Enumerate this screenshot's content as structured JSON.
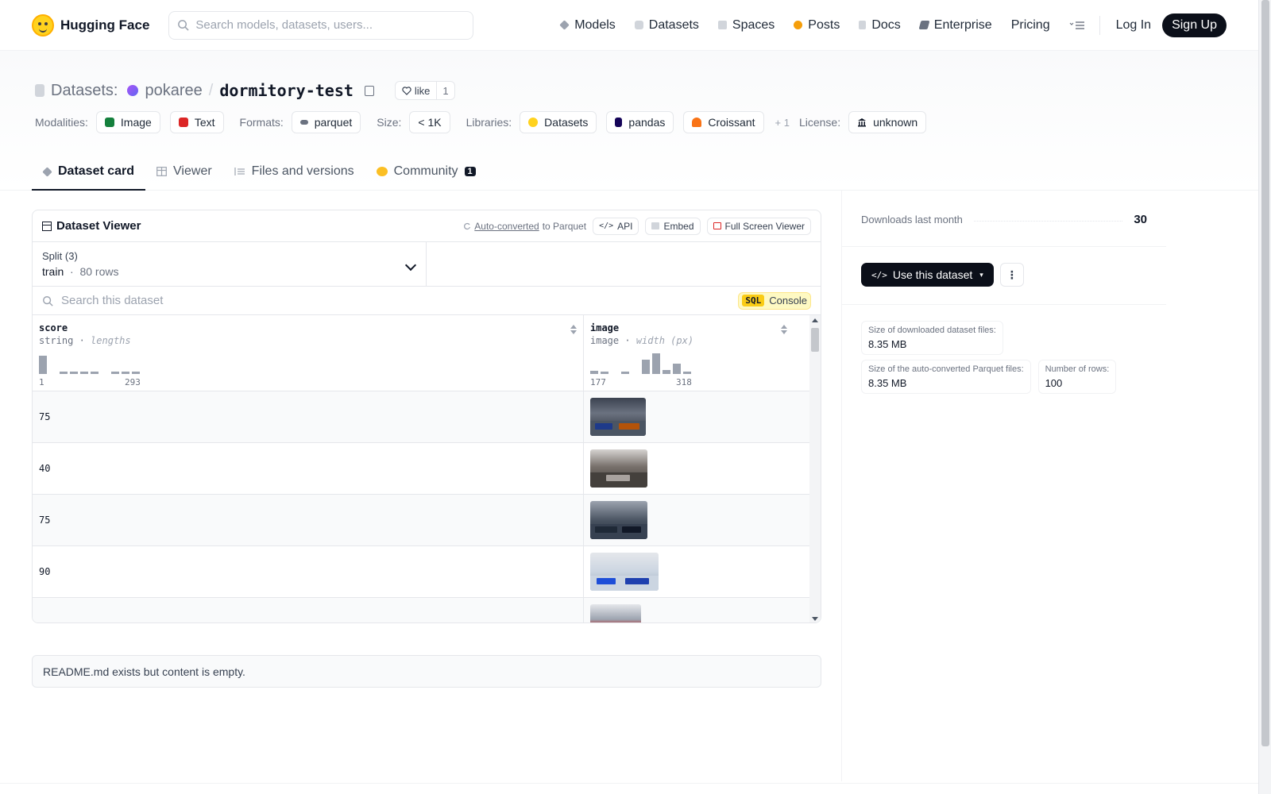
{
  "nav": {
    "brand": "Hugging Face",
    "search_placeholder": "Search models, datasets, users...",
    "links": [
      {
        "label": "Models",
        "icon": "cube-icon",
        "color": "#9ca3af"
      },
      {
        "label": "Datasets",
        "icon": "database-icon",
        "color": "#9ca3af"
      },
      {
        "label": "Spaces",
        "icon": "grid-icon",
        "color": "#9ca3af"
      },
      {
        "label": "Posts",
        "icon": "speech-icon",
        "color": "#f59e0b"
      },
      {
        "label": "Docs",
        "icon": "doc-icon",
        "color": "#9ca3af"
      },
      {
        "label": "Enterprise",
        "icon": "enterprise-icon",
        "color": "#6b7280"
      },
      {
        "label": "Pricing"
      }
    ],
    "login": "Log In",
    "signup": "Sign Up"
  },
  "header": {
    "crumb_label": "Datasets:",
    "owner": "pokaree",
    "repo": "dormitory-test",
    "like_label": "like",
    "like_count": "1",
    "modalities_label": "Modalities:",
    "modalities": [
      {
        "label": "Image",
        "color": "#15803d"
      },
      {
        "label": "Text",
        "color": "#dc2626"
      }
    ],
    "formats_label": "Formats:",
    "format": "parquet",
    "size_label": "Size:",
    "size": "< 1K",
    "libraries_label": "Libraries:",
    "libraries": [
      {
        "label": "Datasets",
        "color": "#ffd21e"
      },
      {
        "label": "pandas",
        "color": "#150458"
      },
      {
        "label": "Croissant",
        "color": "#f97316"
      }
    ],
    "libraries_more": "+ 1",
    "license_label": "License:",
    "license": "unknown"
  },
  "tabs": [
    {
      "label": "Dataset card",
      "active": true
    },
    {
      "label": "Viewer"
    },
    {
      "label": "Files and versions"
    },
    {
      "label": "Community",
      "badge": "1"
    }
  ],
  "viewer": {
    "title": "Dataset Viewer",
    "auto_converted": "Auto-converted",
    "to_parquet": "to Parquet",
    "api": "API",
    "embed": "Embed",
    "fullscreen": "Full Screen Viewer",
    "split_label": "Split (3)",
    "split_name": "train",
    "split_rows": "80 rows",
    "search_placeholder": "Search this dataset",
    "sql_tag": "SQL",
    "sql_label": "Console",
    "columns": [
      {
        "name": "score",
        "type": "string",
        "stat": "lengths",
        "min": "1",
        "max": "293",
        "hist": [
          0.9,
          0,
          0.1,
          0.1,
          0.1,
          0.1,
          0,
          0.1,
          0.1,
          0.1
        ]
      },
      {
        "name": "image",
        "type": "image",
        "stat": "width (px)",
        "min": "177",
        "max": "318",
        "hist": [
          0.15,
          0.1,
          0,
          0.1,
          0,
          0.7,
          1,
          0.2,
          0.5,
          0.1
        ]
      }
    ],
    "rows": [
      {
        "score": "75"
      },
      {
        "score": "40"
      },
      {
        "score": "75"
      },
      {
        "score": "90"
      },
      {
        "score": ""
      }
    ]
  },
  "readme": "README.md exists but content is empty.",
  "sidebar": {
    "downloads_label": "Downloads last month",
    "downloads": "30",
    "use_button": "Use this dataset",
    "stats": [
      {
        "label": "Size of downloaded dataset files:",
        "value": "8.35 MB"
      },
      {
        "label": "Size of the auto-converted Parquet files:",
        "value": "8.35 MB"
      },
      {
        "label": "Number of rows:",
        "value": "100"
      }
    ]
  }
}
